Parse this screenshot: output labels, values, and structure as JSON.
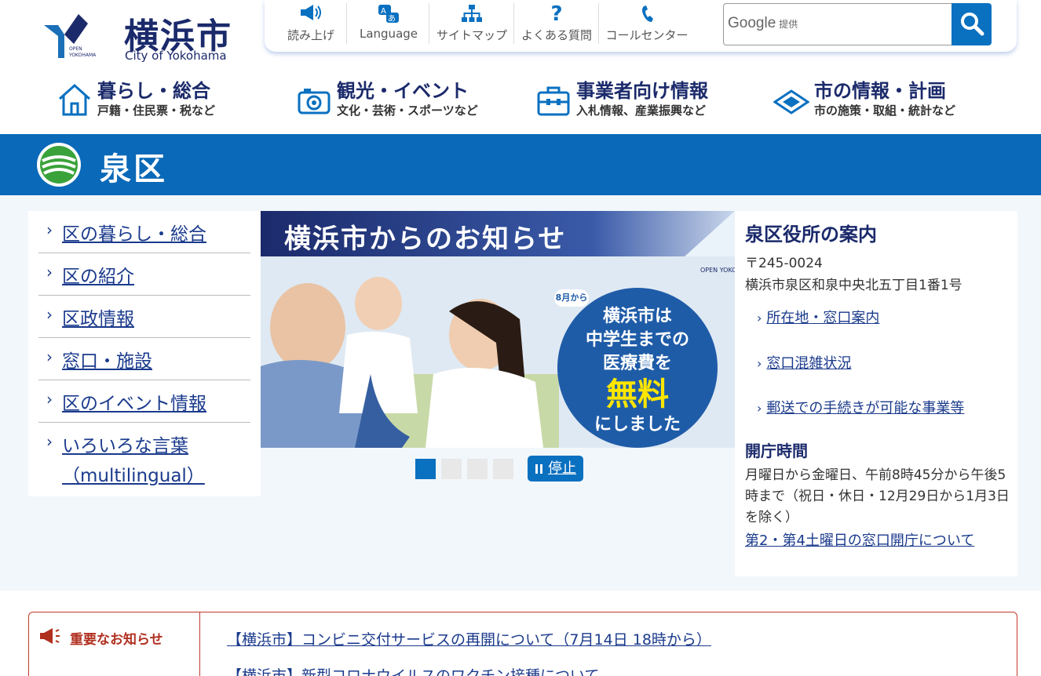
{
  "header": {
    "logo_kanji": "横浜市",
    "logo_en": "City of Yokohama",
    "logo_mark_text": "OPEN YOKOHAMA",
    "util": [
      {
        "label": "読み上げ",
        "icon": "speaker-icon"
      },
      {
        "label": "Language",
        "icon": "language-icon"
      },
      {
        "label": "サイトマップ",
        "icon": "sitemap-icon"
      },
      {
        "label": "よくある質問",
        "icon": "question-icon"
      },
      {
        "label": "コールセンター",
        "icon": "phone-icon"
      }
    ],
    "search": {
      "brand": "Google",
      "brand_sub": "提供",
      "button_icon": "search-icon"
    }
  },
  "mainnav": [
    {
      "title": "暮らし・総合",
      "sub": "戸籍・住民票・税など",
      "icon": "house-icon"
    },
    {
      "title": "観光・イベント",
      "sub": "文化・芸術・スポーツなど",
      "icon": "camera-icon"
    },
    {
      "title": "事業者向け情報",
      "sub": "入札情報、産業振興など",
      "icon": "briefcase-icon"
    },
    {
      "title": "市の情報・計画",
      "sub": "市の施策・取組・統計など",
      "icon": "diamond-icon"
    }
  ],
  "ward": {
    "name": "泉区"
  },
  "leftnav": [
    {
      "label": "区の暮らし・総合"
    },
    {
      "label": "区の紹介"
    },
    {
      "label": "区政情報"
    },
    {
      "label": "窓口・施設"
    },
    {
      "label": "区のイベント情報"
    },
    {
      "label": "いろいろな言葉",
      "label2": "（multilingual）"
    }
  ],
  "slider": {
    "heading": "横浜市からのお知らせ",
    "badge_tag": "8月から",
    "badge_line1": "横浜市は",
    "badge_line2": "中学生までの",
    "badge_line3": "医療費を",
    "badge_free": "無料",
    "badge_line4": "にしました",
    "stop_label": "停止",
    "dots": 4,
    "active_dot": 1
  },
  "office": {
    "title": "泉区役所の案内",
    "postal": "〒245-0024",
    "address": "横浜市泉区和泉中央北五丁目1番1号",
    "links": [
      "所在地・窓口案内",
      "窓口混雑状況",
      "郵送での手続きが可能な事業等"
    ],
    "hours_title": "開庁時間",
    "hours_text": "月曜日から金曜日、午前8時45分から午後5時まで（祝日・休日・12月29日から1月3日を除く）",
    "hours_link": "第2・第4土曜日の窓口開庁について"
  },
  "notice": {
    "title": "重要なお知らせ",
    "items": [
      "【横浜市】コンビニ交付サービスの再開について（7月14日 18時から）",
      "【横浜市】新型コロナウイルスのワクチン接種について"
    ]
  },
  "colors": {
    "brand_blue": "#0a69b8",
    "navy": "#1b2a6b",
    "alert_red": "#b03020",
    "green": "#3aa23a"
  }
}
